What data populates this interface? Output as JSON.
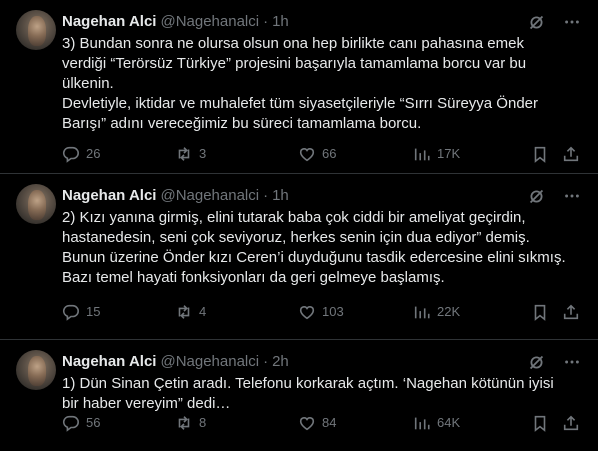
{
  "colors": {
    "background": "#000000",
    "text": "#e7e9ea",
    "muted": "#71767b",
    "border": "#2f3336"
  },
  "icons": {
    "reply": "speech-bubble-icon",
    "retweet": "retweet-icon",
    "like": "heart-icon",
    "views": "bar-chart-icon",
    "bookmark": "bookmark-icon",
    "share": "share-icon",
    "grok": "grok-icon",
    "more": "more-dots-icon"
  },
  "tweets": [
    {
      "name": "Nagehan Alci",
      "handle": "@Nagehanalci",
      "separator": "·",
      "time": "1h",
      "lines": [
        "3) Bundan sonra ne olursa olsun ona hep birlikte canı pahasına emek",
        "verdiği “Terörsüz Türkiye” projesini başarıyla tamamlama borcu var bu",
        "ülkenin.",
        "Devletiyle, iktidar ve muhalefet tüm siyasetçileriyle “Sırrı Süreyya Önder",
        "Barışı” adını vereceğimiz bu süreci tamamlama borcu."
      ],
      "stats": {
        "replies": "26",
        "retweets": "3",
        "likes": "66",
        "views": "17K"
      }
    },
    {
      "name": "Nagehan Alci",
      "handle": "@Nagehanalci",
      "separator": "·",
      "time": "1h",
      "lines": [
        "2) Kızı yanına girmiş, elini tutarak baba çok ciddi bir ameliyat geçirdin,",
        "hastanedesin, seni çok seviyoruz, herkes senin için dua ediyor” demiş.",
        "Bunun üzerine Önder kızı Ceren’i duyduğunu tasdik edercesine elini sıkmış.",
        "Bazı temel hayati fonksiyonları da geri gelmeye başlamış."
      ],
      "stats": {
        "replies": "15",
        "retweets": "4",
        "likes": "103",
        "views": "22K"
      }
    },
    {
      "name": "Nagehan Alci",
      "handle": "@Nagehanalci",
      "separator": "·",
      "time": "2h",
      "lines": [
        "1) Dün Sinan Çetin aradı. Telefonu korkarak açtım. ‘Nagehan kötünün iyisi",
        "bir haber vereyim” dedi…"
      ],
      "stats": {
        "replies": "56",
        "retweets": "8",
        "likes": "84",
        "views": "64K"
      }
    }
  ]
}
